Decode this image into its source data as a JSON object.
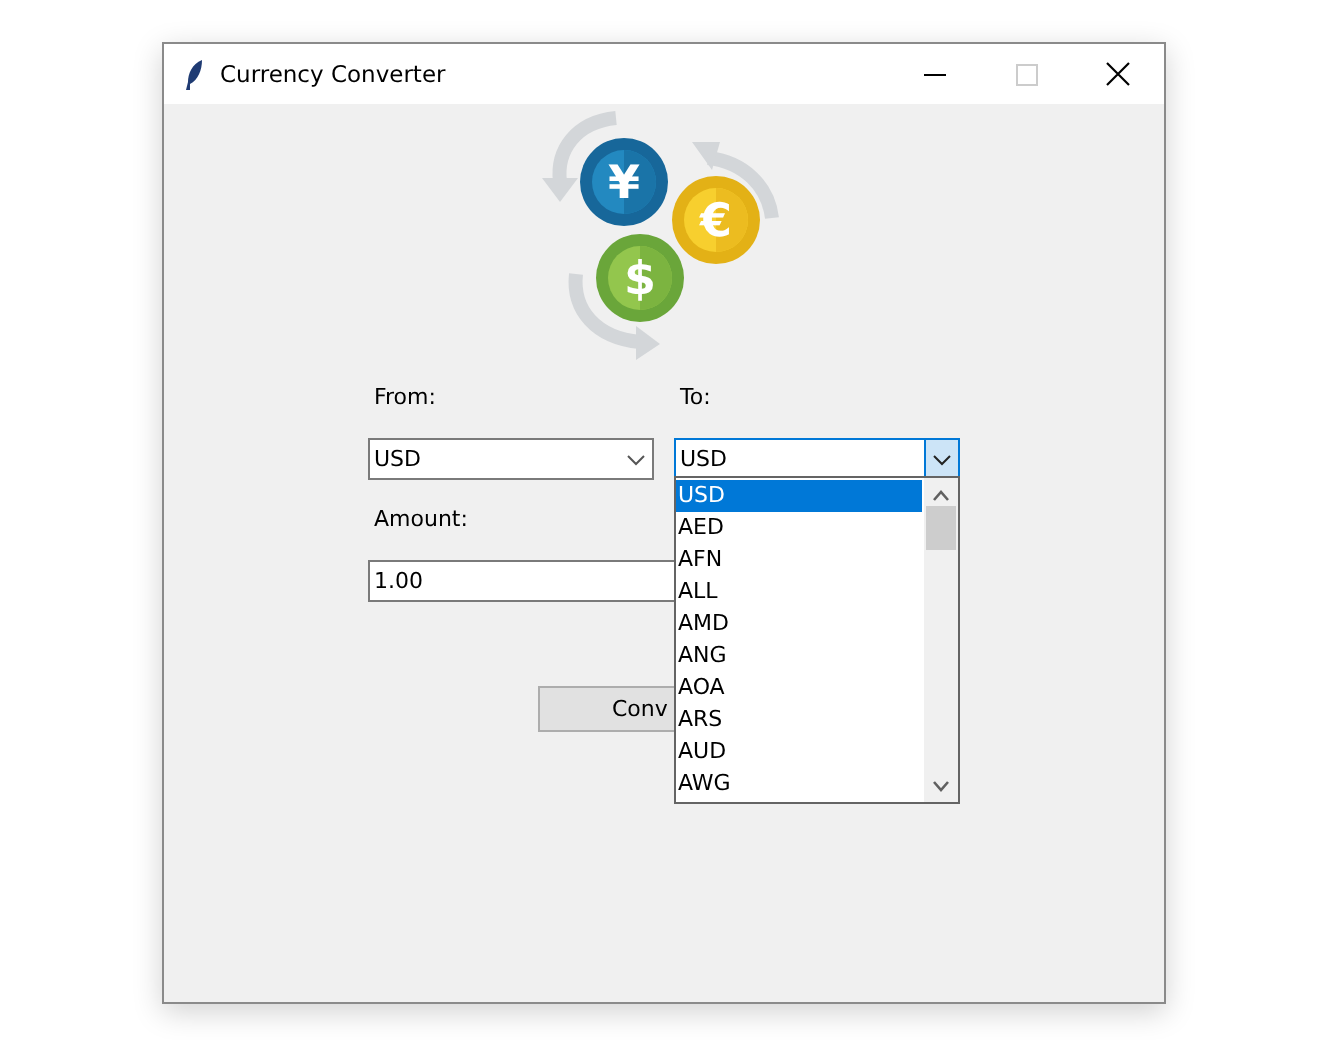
{
  "window": {
    "title": "Currency Converter"
  },
  "logo": {
    "symbols": [
      "¥",
      "€",
      "$"
    ]
  },
  "from": {
    "label": "From:",
    "value": "USD",
    "expanded": false
  },
  "to": {
    "label": "To:",
    "value": "USD",
    "expanded": true,
    "options": [
      {
        "label": "USD",
        "selected": true
      },
      {
        "label": "AED",
        "selected": false
      },
      {
        "label": "AFN",
        "selected": false
      },
      {
        "label": "ALL",
        "selected": false
      },
      {
        "label": "AMD",
        "selected": false
      },
      {
        "label": "ANG",
        "selected": false
      },
      {
        "label": "AOA",
        "selected": false
      },
      {
        "label": "ARS",
        "selected": false
      },
      {
        "label": "AUD",
        "selected": false
      },
      {
        "label": "AWG",
        "selected": false
      }
    ]
  },
  "amount": {
    "label": "Amount:",
    "value": "1.00"
  },
  "convert_button": {
    "label": "Conv"
  }
}
